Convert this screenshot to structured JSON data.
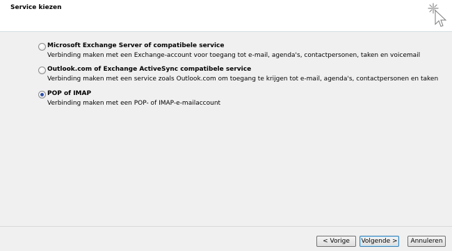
{
  "header": {
    "title": "Service kiezen",
    "icon": "wizard-cursor-icon"
  },
  "options": [
    {
      "title": "Microsoft Exchange Server of compatibele service",
      "description": "Verbinding maken met een Exchange-account voor toegang tot e-mail, agenda's, contactpersonen, taken en voicemail",
      "checked": false
    },
    {
      "title": "Outlook.com of Exchange ActiveSync compatibele service",
      "description": "Verbinding maken met een service zoals Outlook.com om toegang te krijgen tot e-mail, agenda's, contactpersonen en taken",
      "checked": false
    },
    {
      "title": "POP of IMAP",
      "description": "Verbinding maken met een POP- of IMAP-e-mailaccount",
      "checked": true
    }
  ],
  "buttons": {
    "back_label": "< Vorige",
    "next_label": "Volgende >",
    "cancel_label": "Annuleren"
  },
  "colors": {
    "dialog_background": "#f0f0f0",
    "header_background": "#ffffff",
    "radio_selected": "#2a4fa8"
  }
}
